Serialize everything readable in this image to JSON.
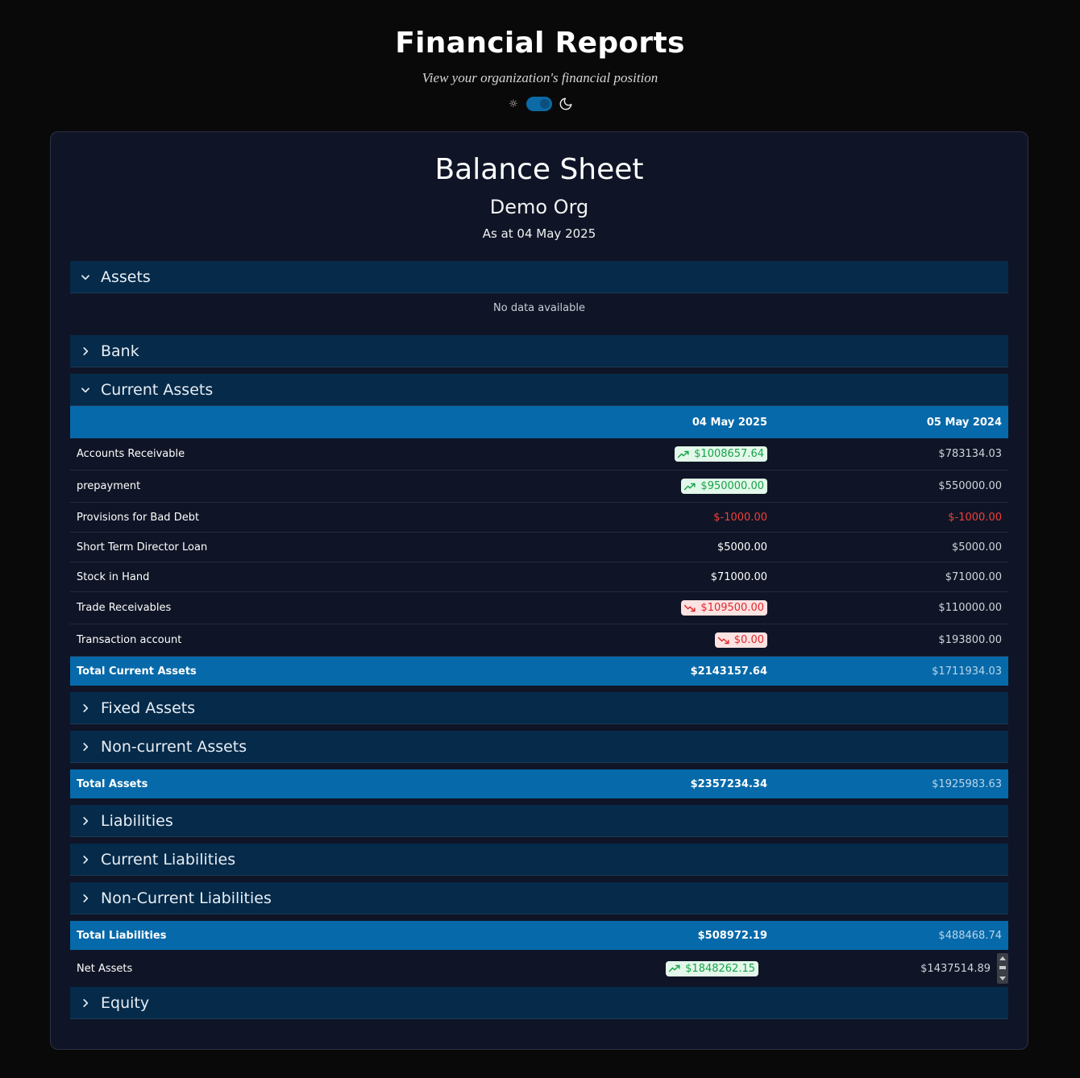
{
  "header": {
    "title": "Financial Reports",
    "subtitle": "View your organization's financial position",
    "theme": {
      "light_icon": "sun-icon",
      "dark_icon": "moon-icon",
      "mode": "dark"
    }
  },
  "report": {
    "title": "Balance Sheet",
    "org": "Demo Org",
    "as_at": "As at 04 May 2025"
  },
  "sections": {
    "assets": {
      "label": "Assets",
      "expanded": true,
      "empty_text": "No data available"
    },
    "bank": {
      "label": "Bank",
      "expanded": false
    },
    "current_assets": {
      "label": "Current Assets",
      "expanded": true
    },
    "fixed_assets": {
      "label": "Fixed Assets",
      "expanded": false
    },
    "non_current_assets": {
      "label": "Non-current Assets",
      "expanded": false
    },
    "liabilities": {
      "label": "Liabilities",
      "expanded": false
    },
    "current_liabilities": {
      "label": "Current Liabilities",
      "expanded": false
    },
    "non_current_liabilities": {
      "label": "Non-Current Liabilities",
      "expanded": false
    },
    "equity": {
      "label": "Equity",
      "expanded": false
    }
  },
  "columns": {
    "current": "04 May 2025",
    "previous": "05 May 2024"
  },
  "current_assets_rows": [
    {
      "name": "Accounts Receivable",
      "current": "$1008657.64",
      "previous": "$783134.03",
      "trend": "up"
    },
    {
      "name": "prepayment",
      "current": "$950000.00",
      "previous": "$550000.00",
      "trend": "up"
    },
    {
      "name": "Provisions for Bad Debt",
      "current": "$-1000.00",
      "previous": "$-1000.00",
      "trend": "negative"
    },
    {
      "name": "Short Term Director Loan",
      "current": "$5000.00",
      "previous": "$5000.00",
      "trend": "none"
    },
    {
      "name": "Stock in Hand",
      "current": "$71000.00",
      "previous": "$71000.00",
      "trend": "none"
    },
    {
      "name": "Trade Receivables",
      "current": "$109500.00",
      "previous": "$110000.00",
      "trend": "down"
    },
    {
      "name": "Transaction account",
      "current": "$0.00",
      "previous": "$193800.00",
      "trend": "down"
    }
  ],
  "totals": {
    "current_assets": {
      "label": "Total Current Assets",
      "current": "$2143157.64",
      "previous": "$1711934.03"
    },
    "assets": {
      "label": "Total Assets",
      "current": "$2357234.34",
      "previous": "$1925983.63"
    },
    "liabilities": {
      "label": "Total Liabilities",
      "current": "$508972.19",
      "previous": "$488468.74"
    }
  },
  "net_assets": {
    "label": "Net Assets",
    "current": "$1848262.15",
    "previous": "$1437514.89",
    "trend": "up"
  },
  "colors": {
    "background": "#090909",
    "card": "#0f1526",
    "section_header": "#062a49",
    "accent": "#0669a9",
    "positive": "#16a34a",
    "negative": "#e0282b"
  }
}
